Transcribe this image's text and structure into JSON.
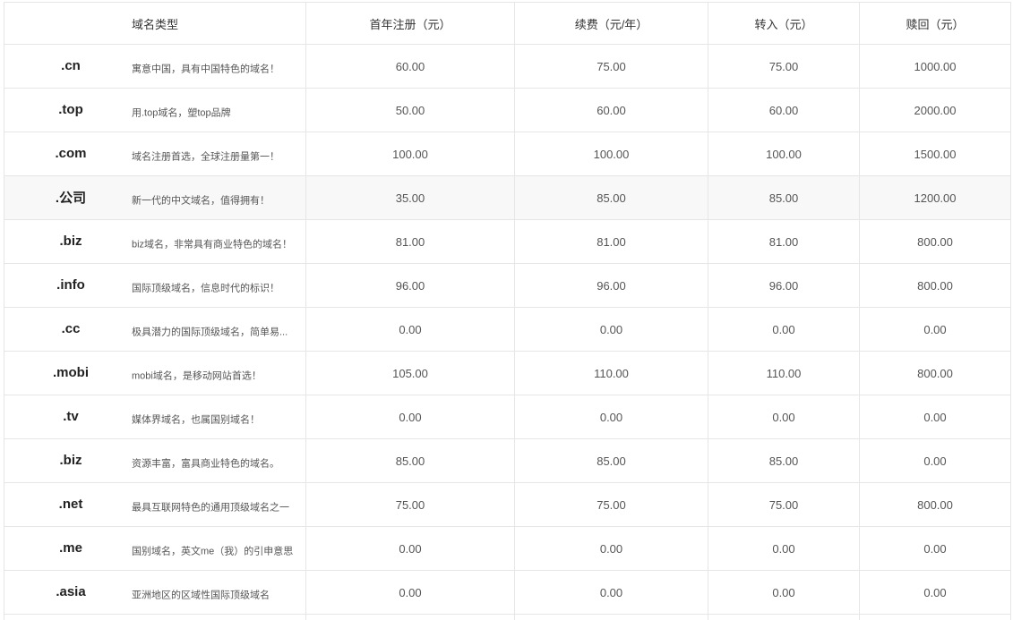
{
  "header": {
    "type": "域名类型",
    "first_year": "首年注册（元）",
    "renew": "续费（元/年）",
    "transfer": "转入（元）",
    "redeem": "赎回（元）"
  },
  "rows": [
    {
      "tld": ".cn",
      "desc": "寓意中国，具有中国特色的域名！",
      "first_year": "60.00",
      "renew": "75.00",
      "transfer": "75.00",
      "redeem": "1000.00"
    },
    {
      "tld": ".top",
      "desc": "用.top域名，塑top品牌",
      "first_year": "50.00",
      "renew": "60.00",
      "transfer": "60.00",
      "redeem": "2000.00"
    },
    {
      "tld": ".com",
      "desc": "域名注册首选，全球注册量第一！",
      "first_year": "100.00",
      "renew": "100.00",
      "transfer": "100.00",
      "redeem": "1500.00"
    },
    {
      "tld": ".公司",
      "desc": "新一代的中文域名，值得拥有！",
      "first_year": "35.00",
      "renew": "85.00",
      "transfer": "85.00",
      "redeem": "1200.00"
    },
    {
      "tld": ".biz",
      "desc": "biz域名，非常具有商业特色的域名！",
      "first_year": "81.00",
      "renew": "81.00",
      "transfer": "81.00",
      "redeem": "800.00"
    },
    {
      "tld": ".info",
      "desc": "国际顶级域名，信息时代的标识！",
      "first_year": "96.00",
      "renew": "96.00",
      "transfer": "96.00",
      "redeem": "800.00"
    },
    {
      "tld": ".cc",
      "desc": "极具潜力的国际顶级域名，简单易...",
      "first_year": "0.00",
      "renew": "0.00",
      "transfer": "0.00",
      "redeem": "0.00"
    },
    {
      "tld": ".mobi",
      "desc": "mobi域名，是移动网站首选！",
      "first_year": "105.00",
      "renew": "110.00",
      "transfer": "110.00",
      "redeem": "800.00"
    },
    {
      "tld": ".tv",
      "desc": "媒体界域名，也属国别域名！",
      "first_year": "0.00",
      "renew": "0.00",
      "transfer": "0.00",
      "redeem": "0.00"
    },
    {
      "tld": ".biz",
      "desc": "资源丰富，富具商业特色的域名。",
      "first_year": "85.00",
      "renew": "85.00",
      "transfer": "85.00",
      "redeem": "0.00"
    },
    {
      "tld": ".net",
      "desc": "最具互联网特色的通用顶级域名之一",
      "first_year": "75.00",
      "renew": "75.00",
      "transfer": "75.00",
      "redeem": "800.00"
    },
    {
      "tld": ".me",
      "desc": "国别域名，英文me（我）的引申意思",
      "first_year": "0.00",
      "renew": "0.00",
      "transfer": "0.00",
      "redeem": "0.00"
    },
    {
      "tld": ".asia",
      "desc": "亚洲地区的区域性国际顶级域名",
      "first_year": "0.00",
      "renew": "0.00",
      "transfer": "0.00",
      "redeem": "0.00"
    }
  ],
  "highlight_row": 3,
  "colors": {
    "border": "#e6e6e6",
    "highlight_bg": "#f8f8f8",
    "tld_text": "#222222",
    "body_text": "#555555"
  }
}
